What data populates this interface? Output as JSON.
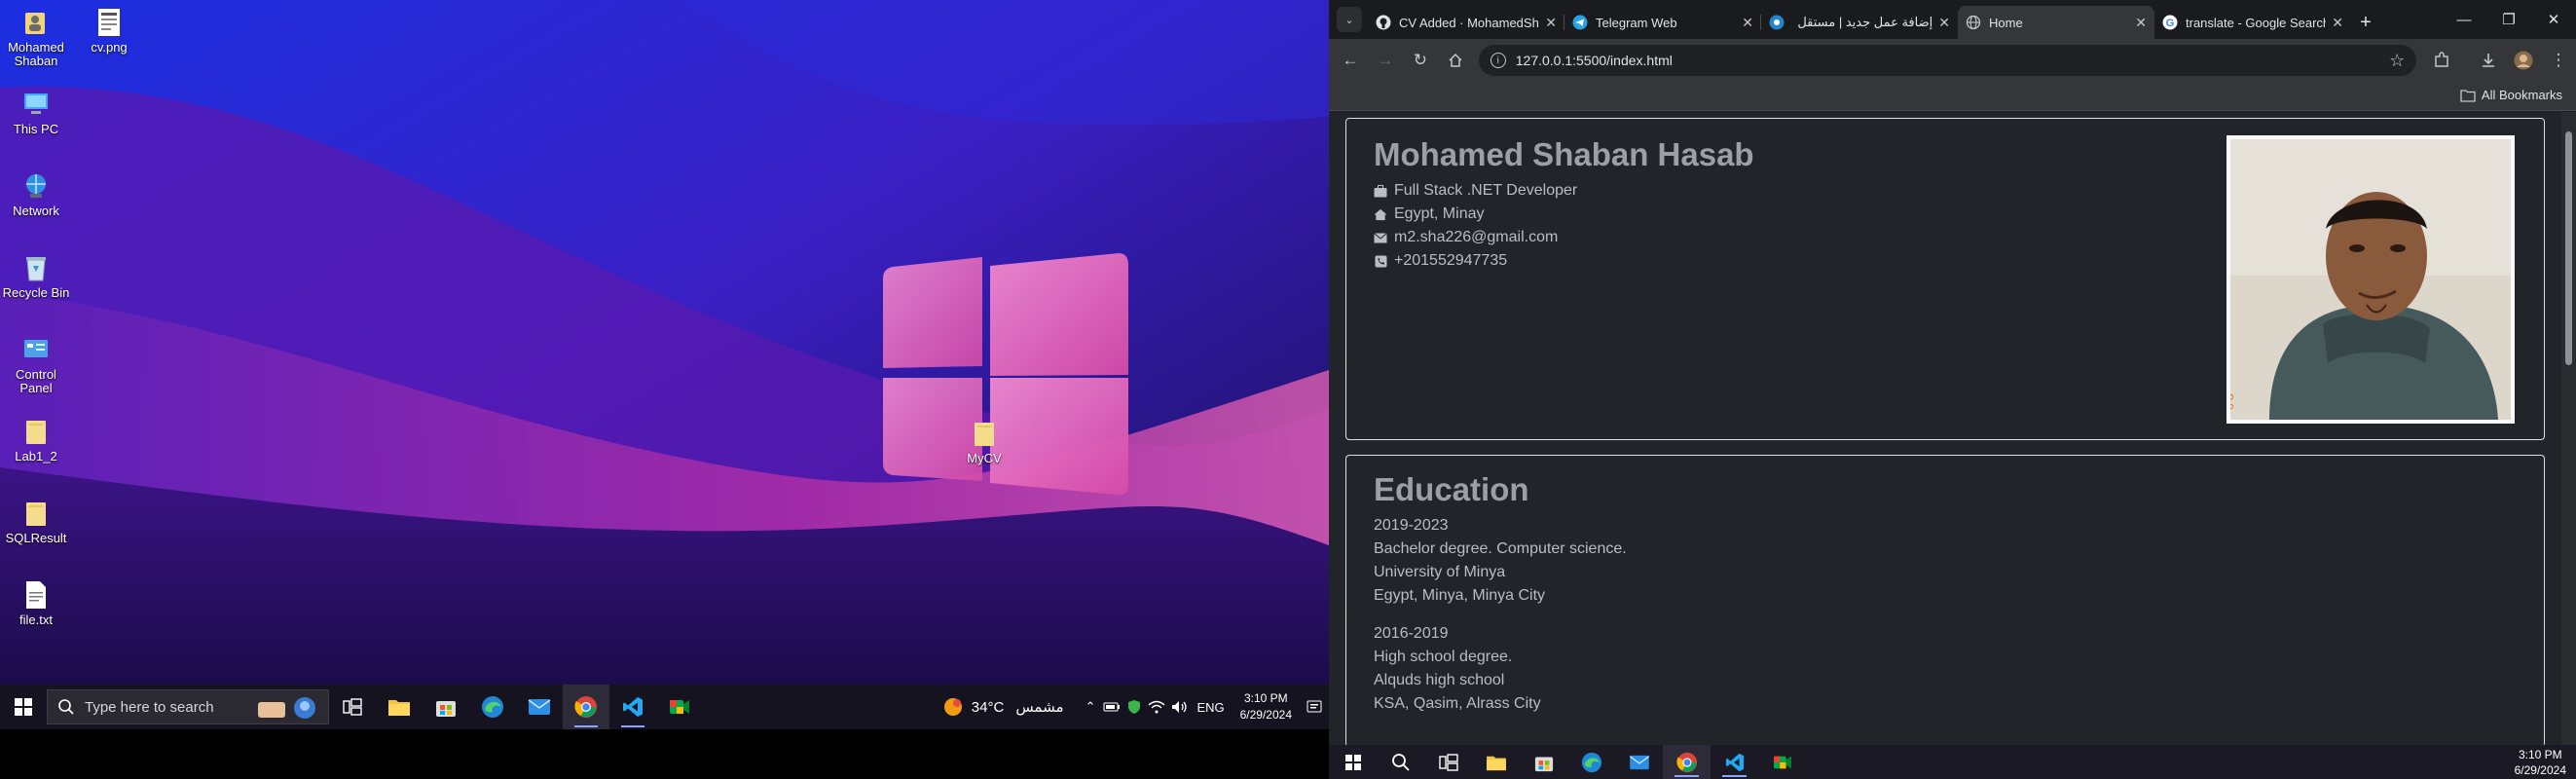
{
  "desktop": {
    "icons": [
      {
        "label": "Mohamed Shaban",
        "icon": "folder-user-icon"
      },
      {
        "label": "cv.png",
        "icon": "image-file-icon"
      },
      {
        "label": "This PC",
        "icon": "computer-icon"
      },
      {
        "label": "Network",
        "icon": "network-icon"
      },
      {
        "label": "Recycle Bin",
        "icon": "recycle-bin-icon"
      },
      {
        "label": "Control Panel",
        "icon": "control-panel-icon"
      },
      {
        "label": "Lab1_2",
        "icon": "folder-icon"
      },
      {
        "label": "SQLResult",
        "icon": "folder-icon"
      },
      {
        "label": "file.txt",
        "icon": "text-file-icon"
      },
      {
        "label": "MyCV",
        "icon": "folder-icon"
      }
    ]
  },
  "taskbar_left": {
    "search_placeholder": "Type here to search",
    "weather_temp": "34°C",
    "weather_text": "مشمس",
    "lang": "ENG",
    "time": "3:10 PM",
    "date": "6/29/2024"
  },
  "browser": {
    "tabs": [
      {
        "title": "CV Added · MohamedSh",
        "icon": "github-icon"
      },
      {
        "title": "Telegram Web",
        "icon": "telegram-icon"
      },
      {
        "title": "إضافة عمل جديد | مستقل",
        "icon": "mostaql-icon"
      },
      {
        "title": "Home",
        "icon": "globe-icon"
      },
      {
        "title": "translate - Google Search",
        "icon": "google-icon"
      }
    ],
    "url": "127.0.0.1:5500/index.html",
    "all_bookmarks": "All Bookmarks"
  },
  "cv": {
    "name": "Mohamed Shaban Hasab",
    "job": "Full Stack .NET Developer",
    "location": "Egypt, Minay",
    "email": "m2.sha226@gmail.com",
    "phone": "+201552947735",
    "photo_caption": "6 8",
    "education_title": "Education",
    "education": [
      {
        "years": "2019-2023",
        "degree": "Bachelor degree. Computer science.",
        "school": "University of Minya",
        "place": "Egypt, Minya, Minya City"
      },
      {
        "years": "2016-2019",
        "degree": "High school degree.",
        "school": "Alquds high school",
        "place": "KSA, Qasim, Alrass City"
      }
    ]
  },
  "taskbar_right": {
    "time": "3:10 PM",
    "date": "6/29/2024"
  }
}
